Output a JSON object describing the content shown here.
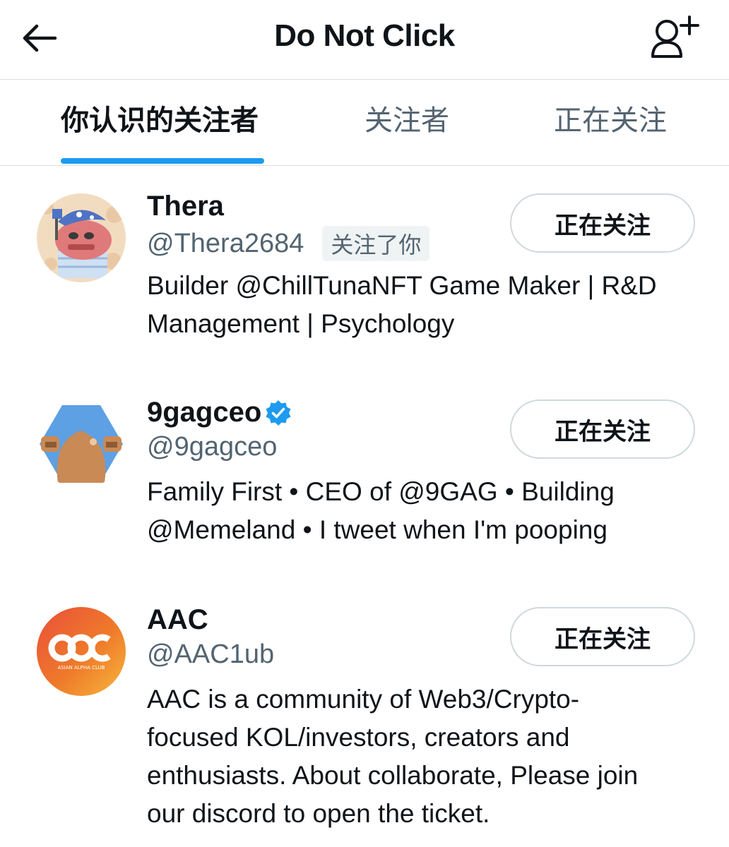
{
  "header": {
    "title": "Do Not Click",
    "back_icon": "arrow-left-icon",
    "add_user_icon": "add-user-icon"
  },
  "tabs": [
    {
      "label": "你认识的关注者",
      "active": true
    },
    {
      "label": "关注者",
      "active": false
    },
    {
      "label": "正在关注",
      "active": false
    }
  ],
  "colors": {
    "accent": "#1d9bf0",
    "verified": "#1d9bf0",
    "secondary_text": "#536471"
  },
  "users": [
    {
      "name": "Thera",
      "handle": "@Thera2684",
      "follows_you_badge": "关注了你",
      "verified": false,
      "bio": "Builder @ChillTunaNFT Game Maker | R&D Management | Psychology",
      "follow_button": "正在关注"
    },
    {
      "name": "9gagceo",
      "handle": "@9gagceo",
      "verified": true,
      "bio": "Family First • CEO of @9GAG • Building @Memeland • I tweet when I'm pooping",
      "follow_button": "正在关注"
    },
    {
      "name": "AAC",
      "handle": "@AAC1ub",
      "avatar_text": "ASIAN ALPHA CLUB",
      "verified": false,
      "bio": "AAC is a community of Web3/Crypto-focused KOL/investors, creators and enthusiasts. About collaborate, Please join our discord to open the ticket.",
      "follow_button": "正在关注"
    }
  ]
}
